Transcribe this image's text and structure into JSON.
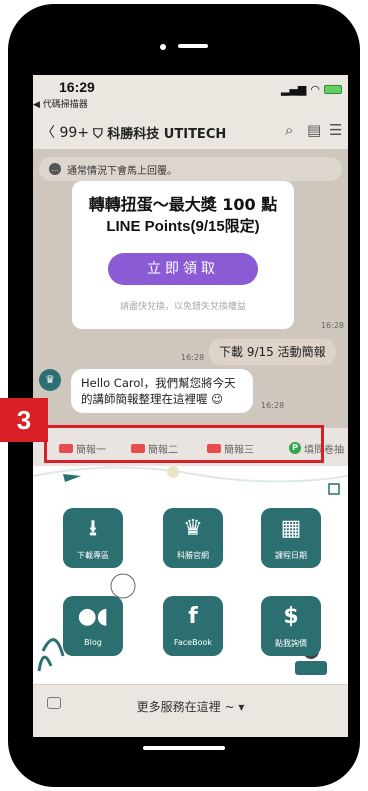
{
  "status": {
    "time": "16:29",
    "back_app": "◀ 代碼掃描器"
  },
  "header": {
    "back": "〈 99+",
    "title": "科勝科技 UTITECH"
  },
  "notice": {
    "text": "通常情況下會馬上回覆。"
  },
  "card": {
    "line1": "轉轉扭蛋～最大獎 100 點",
    "line2": "LINE Points(9/15限定)",
    "button": "立即領取",
    "note": "請盡快兌換，以免錯失兌換權益",
    "time": "16:28"
  },
  "outgoing": {
    "text": "下載 9/15 活動簡報",
    "time": "16:28"
  },
  "incoming": {
    "line1": "Hello Carol，我們幫您將今天",
    "line2": "的講師簡報整理在這裡喔 😉",
    "time": "16:28"
  },
  "step_label": "3",
  "quick_replies": [
    "簡報一",
    "簡報二",
    "簡報三",
    "填問卷抽"
  ],
  "menu": {
    "tiles": [
      {
        "label": "下載專區",
        "icon": "download-icon"
      },
      {
        "label": "科勝官網",
        "icon": "utitech-logo-icon"
      },
      {
        "label": "課程日期",
        "icon": "calendar-icon"
      },
      {
        "label": "Blog",
        "icon": "medium-icon"
      },
      {
        "label": "FaceBook",
        "icon": "facebook-icon"
      },
      {
        "label": "點我詢價",
        "icon": "dollar-icon"
      }
    ]
  },
  "bottom": {
    "more": "更多服務在這裡 ~ ▾"
  },
  "colors": {
    "accent_purple": "#8b5bd6",
    "tile_teal": "#2c6f70",
    "highlight_red": "#d81f26",
    "survey_green": "#2fa847"
  }
}
